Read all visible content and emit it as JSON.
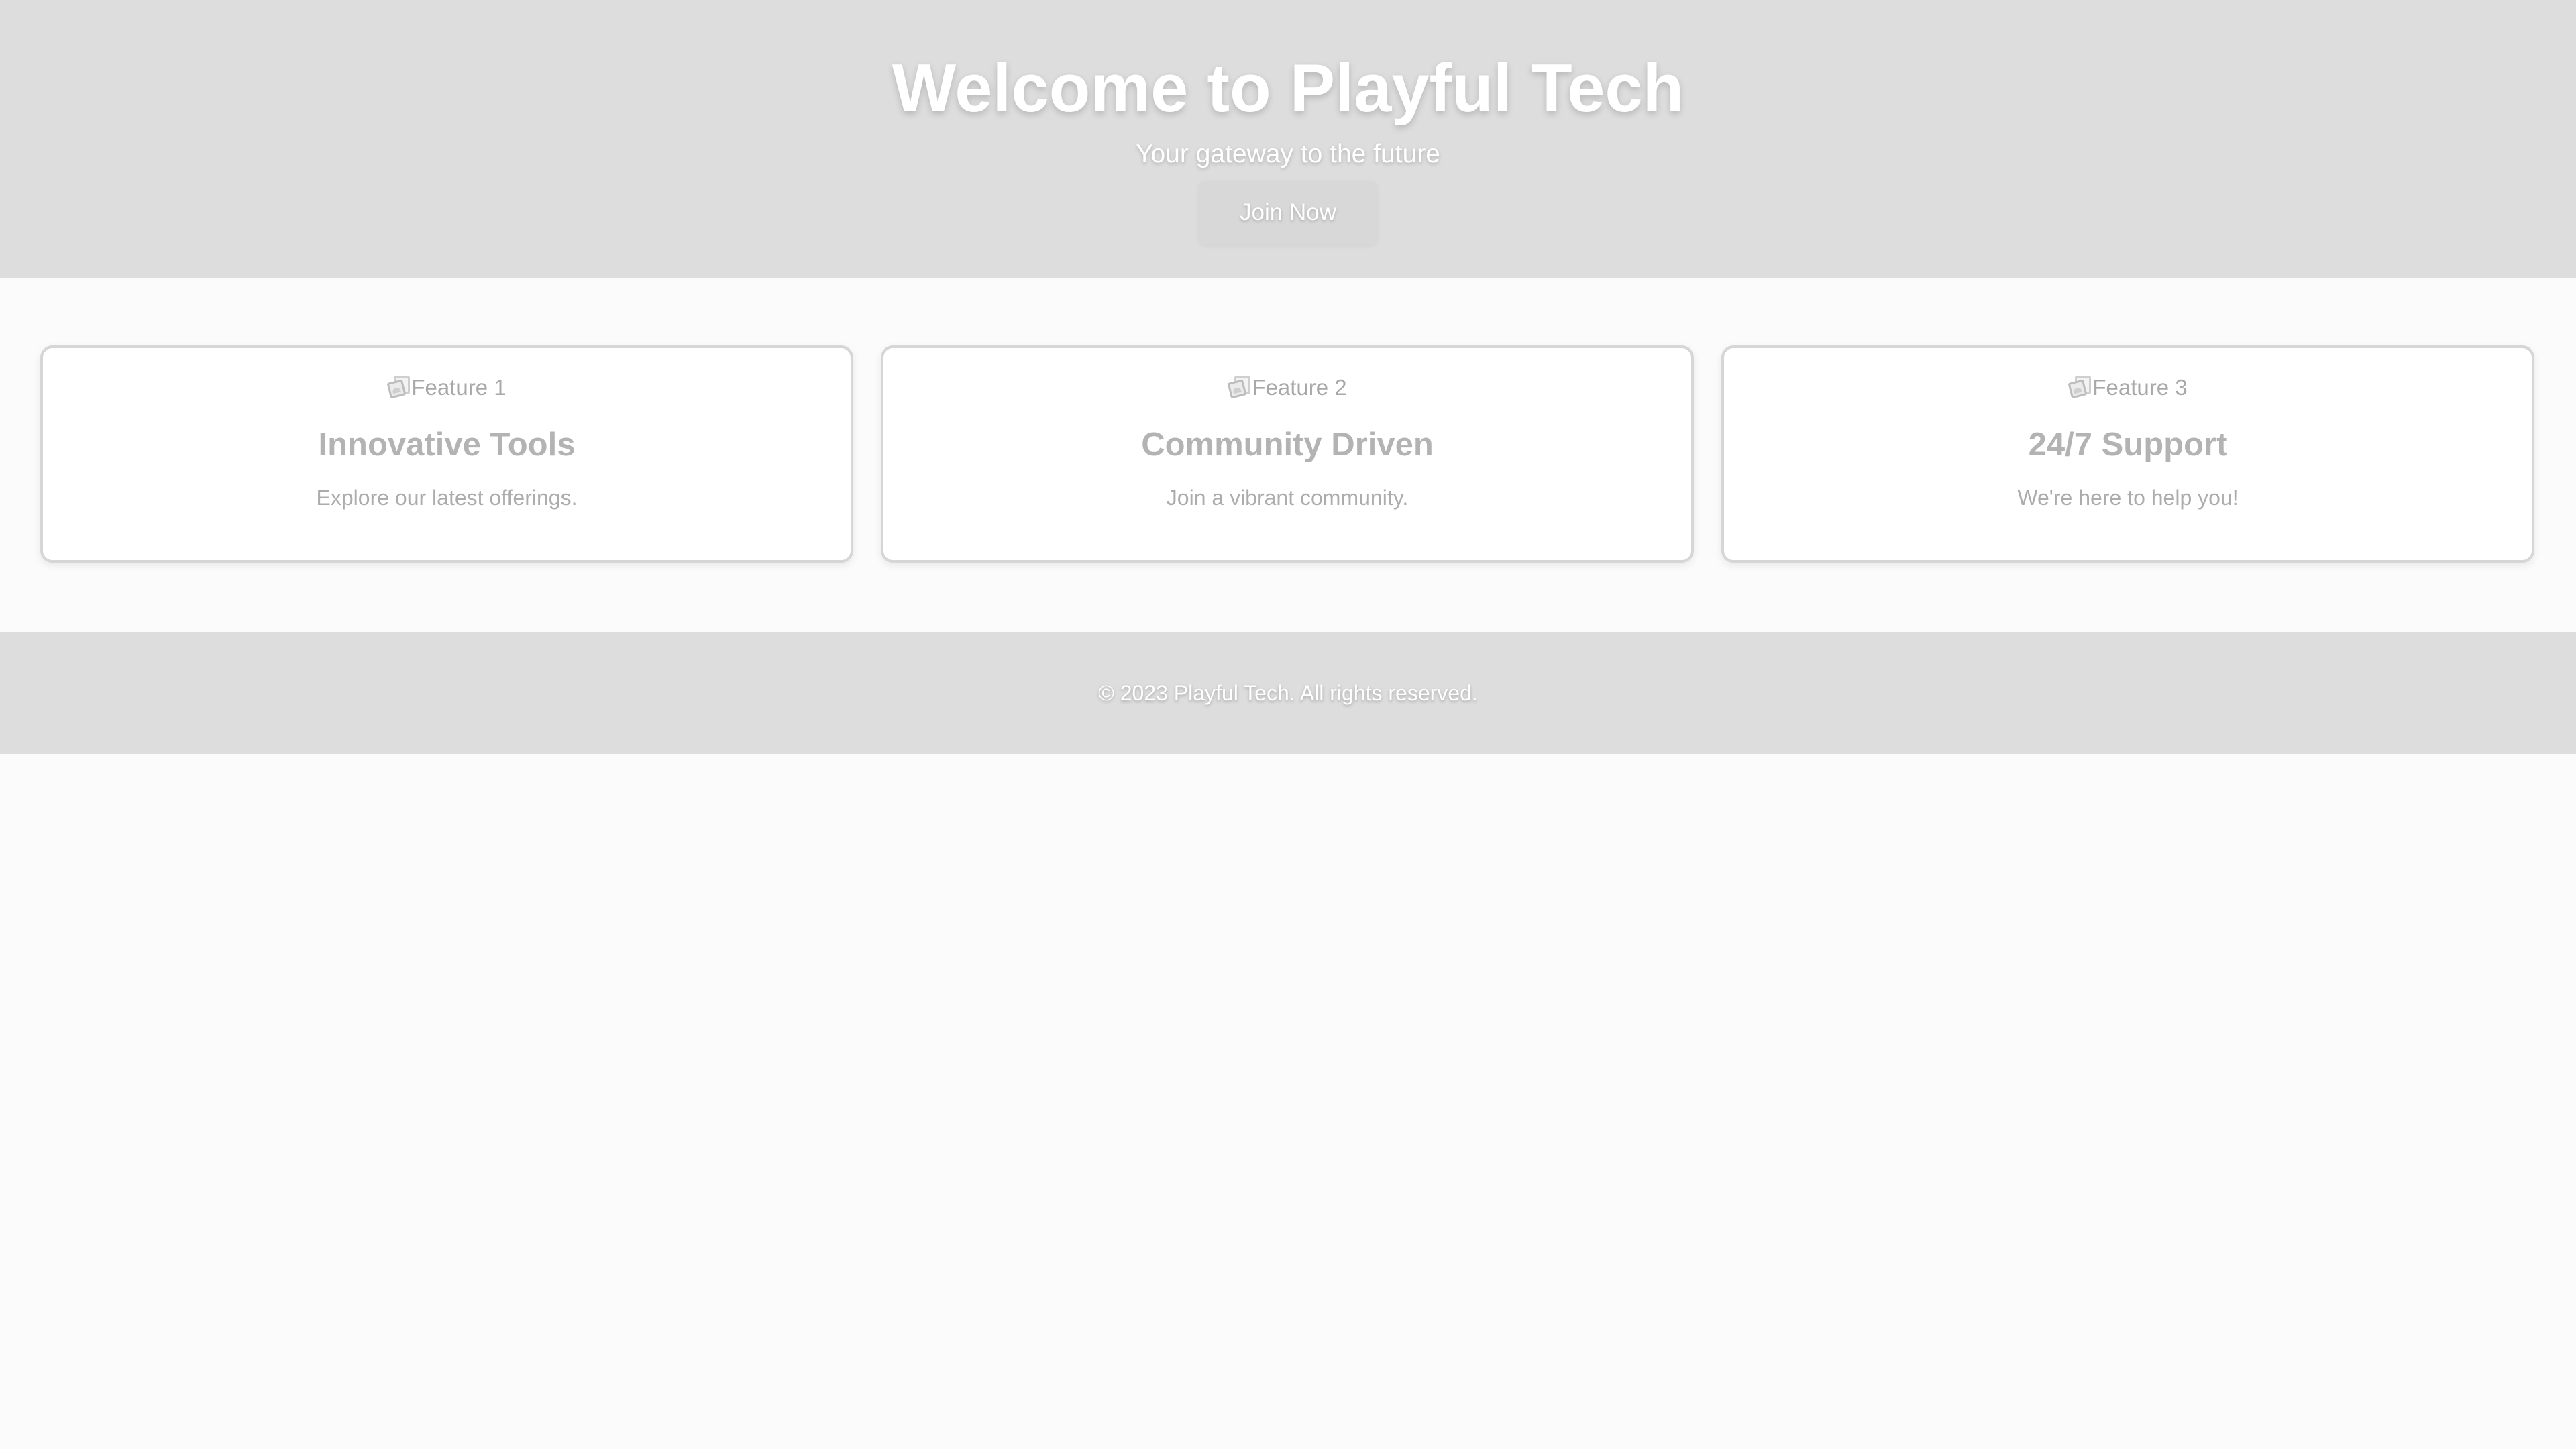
{
  "hero": {
    "title": "Welcome to Playful Tech",
    "subtitle": "Your gateway to the future",
    "button_label": "Join Now"
  },
  "features": [
    {
      "image_alt": "Feature 1",
      "image_icon": "broken-image-icon",
      "title": "Innovative Tools",
      "description": "Explore our latest offerings."
    },
    {
      "image_alt": "Feature 2",
      "image_icon": "broken-image-icon",
      "title": "Community Driven",
      "description": "Join a vibrant community."
    },
    {
      "image_alt": "Feature 3",
      "image_icon": "broken-image-icon",
      "title": "24/7 Support",
      "description": "We're here to help you!"
    }
  ],
  "footer": {
    "copyright": "© 2023 Playful Tech. All rights reserved."
  },
  "colors": {
    "hero_background": "#dddddd",
    "page_background": "#fbfbfb",
    "card_border": "#d6d6d6",
    "muted_text": "#b3b3b3",
    "inverse_text": "#ffffff"
  }
}
